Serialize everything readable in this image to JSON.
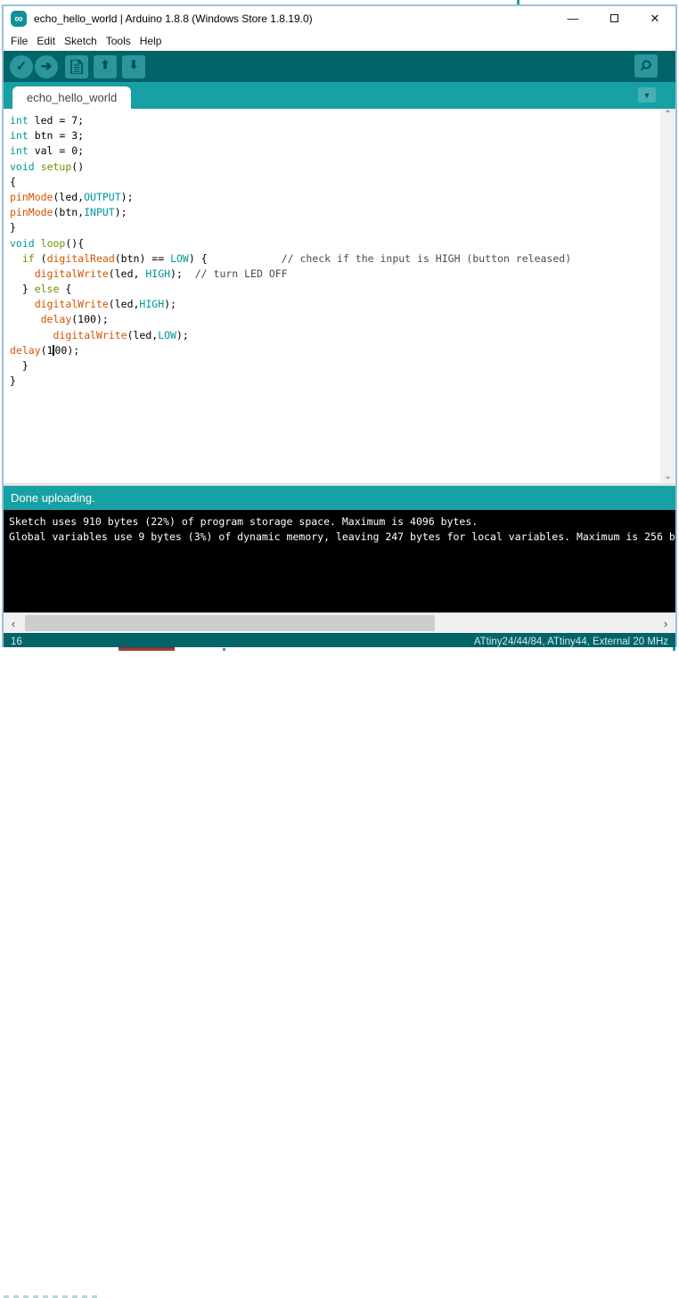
{
  "titlebar": {
    "title": "echo_hello_world | Arduino 1.8.8 (Windows Store 1.8.19.0)",
    "app_icon_glyph": "∞",
    "minimize_glyph": "—",
    "close_glyph": "✕"
  },
  "menubar": {
    "items": [
      "File",
      "Edit",
      "Sketch",
      "Tools",
      "Help"
    ]
  },
  "toolbar": {
    "buttons": [
      "verify",
      "upload",
      "new-sketch",
      "open-sketch",
      "save-sketch"
    ],
    "verify_glyph": "✓",
    "upload_glyph": "➔",
    "open_arrow": "⬆",
    "save_arrow": "⬇",
    "tray_dots": "·····",
    "serial_monitor": "serial-monitor"
  },
  "tabbar": {
    "active_tab": "echo_hello_world",
    "dropdown_glyph": "▼"
  },
  "editor": {
    "code_lines": [
      [
        [
          "int",
          "k"
        ],
        [
          " led = 7;",
          "p"
        ]
      ],
      [
        [
          "int",
          "k"
        ],
        [
          " btn = 3;",
          "p"
        ]
      ],
      [
        [
          "int",
          "k"
        ],
        [
          " val = 0;",
          "p"
        ]
      ],
      [
        [
          "void",
          "k"
        ],
        [
          " ",
          "p"
        ],
        [
          "setup",
          "s"
        ],
        [
          "()",
          "p"
        ]
      ],
      [
        [
          "{",
          "p"
        ]
      ],
      [
        [
          "pinMode",
          "f"
        ],
        [
          "(led,",
          "p"
        ],
        [
          "OUTPUT",
          "k"
        ],
        [
          ");",
          "p"
        ]
      ],
      [
        [
          "pinMode",
          "f"
        ],
        [
          "(btn,",
          "p"
        ],
        [
          "INPUT",
          "k"
        ],
        [
          ");",
          "p"
        ]
      ],
      [
        [
          "}",
          "p"
        ]
      ],
      [
        [
          "void",
          "k"
        ],
        [
          " ",
          "p"
        ],
        [
          "loop",
          "s"
        ],
        [
          "(){",
          "p"
        ]
      ],
      [
        [
          "  ",
          "p"
        ],
        [
          "if",
          "s"
        ],
        [
          " (",
          "p"
        ],
        [
          "digitalRead",
          "f"
        ],
        [
          "(btn) == ",
          "p"
        ],
        [
          "LOW",
          "k"
        ],
        [
          ") {            ",
          "p"
        ],
        [
          "// check if the input is HIGH (button released)",
          "c"
        ]
      ],
      [
        [
          "    ",
          "p"
        ],
        [
          "digitalWrite",
          "f"
        ],
        [
          "(led, ",
          "p"
        ],
        [
          "HIGH",
          "k"
        ],
        [
          ");  ",
          "p"
        ],
        [
          "// turn LED OFF",
          "c"
        ]
      ],
      [
        [
          "  } ",
          "p"
        ],
        [
          "else",
          "s"
        ],
        [
          " {",
          "p"
        ]
      ],
      [
        [
          "    ",
          "p"
        ],
        [
          "digitalWrite",
          "f"
        ],
        [
          "(led,",
          "p"
        ],
        [
          "HIGH",
          "k"
        ],
        [
          ");",
          "p"
        ]
      ],
      [
        [
          "     ",
          "p"
        ],
        [
          "delay",
          "f"
        ],
        [
          "(100);",
          "p"
        ]
      ],
      [
        [
          "       ",
          "p"
        ],
        [
          "digitalWrite",
          "f"
        ],
        [
          "(led,",
          "p"
        ],
        [
          "LOW",
          "k"
        ],
        [
          ");",
          "p"
        ]
      ],
      [
        [
          "delay",
          "f"
        ],
        [
          "(1",
          "p"
        ],
        [
          "",
          "caret"
        ],
        [
          "00);",
          "p"
        ]
      ],
      [
        [
          "  }",
          "p"
        ]
      ],
      [
        [
          "}",
          "p"
        ]
      ]
    ],
    "scroll_up_glyph": "⌃",
    "scroll_down_glyph": "⌄"
  },
  "status_strip": {
    "text": "Done uploading."
  },
  "console": {
    "lines": [
      "Sketch uses 910 bytes (22%) of program storage space. Maximum is 4096 bytes.",
      "Global variables use 9 bytes (3%) of dynamic memory, leaving 247 bytes for local variables. Maximum is 256 b"
    ]
  },
  "hscroll": {
    "left_glyph": "‹",
    "right_glyph": "›"
  },
  "statusbar": {
    "line_number": "16",
    "board_info": "ATtiny24/44/84, ATtiny44, External 20 MHz"
  },
  "colors": {
    "toolbar_dark_teal": "#006468",
    "tabbar_teal": "#17A1A5",
    "button_teal": "#2b969b",
    "keyword_teal": "#00979C",
    "structure_olive": "#728E00",
    "function_orange": "#D35400",
    "comment_gray": "#434F54",
    "console_bg": "#000000",
    "window_border_blue": "#9cc0dc"
  }
}
